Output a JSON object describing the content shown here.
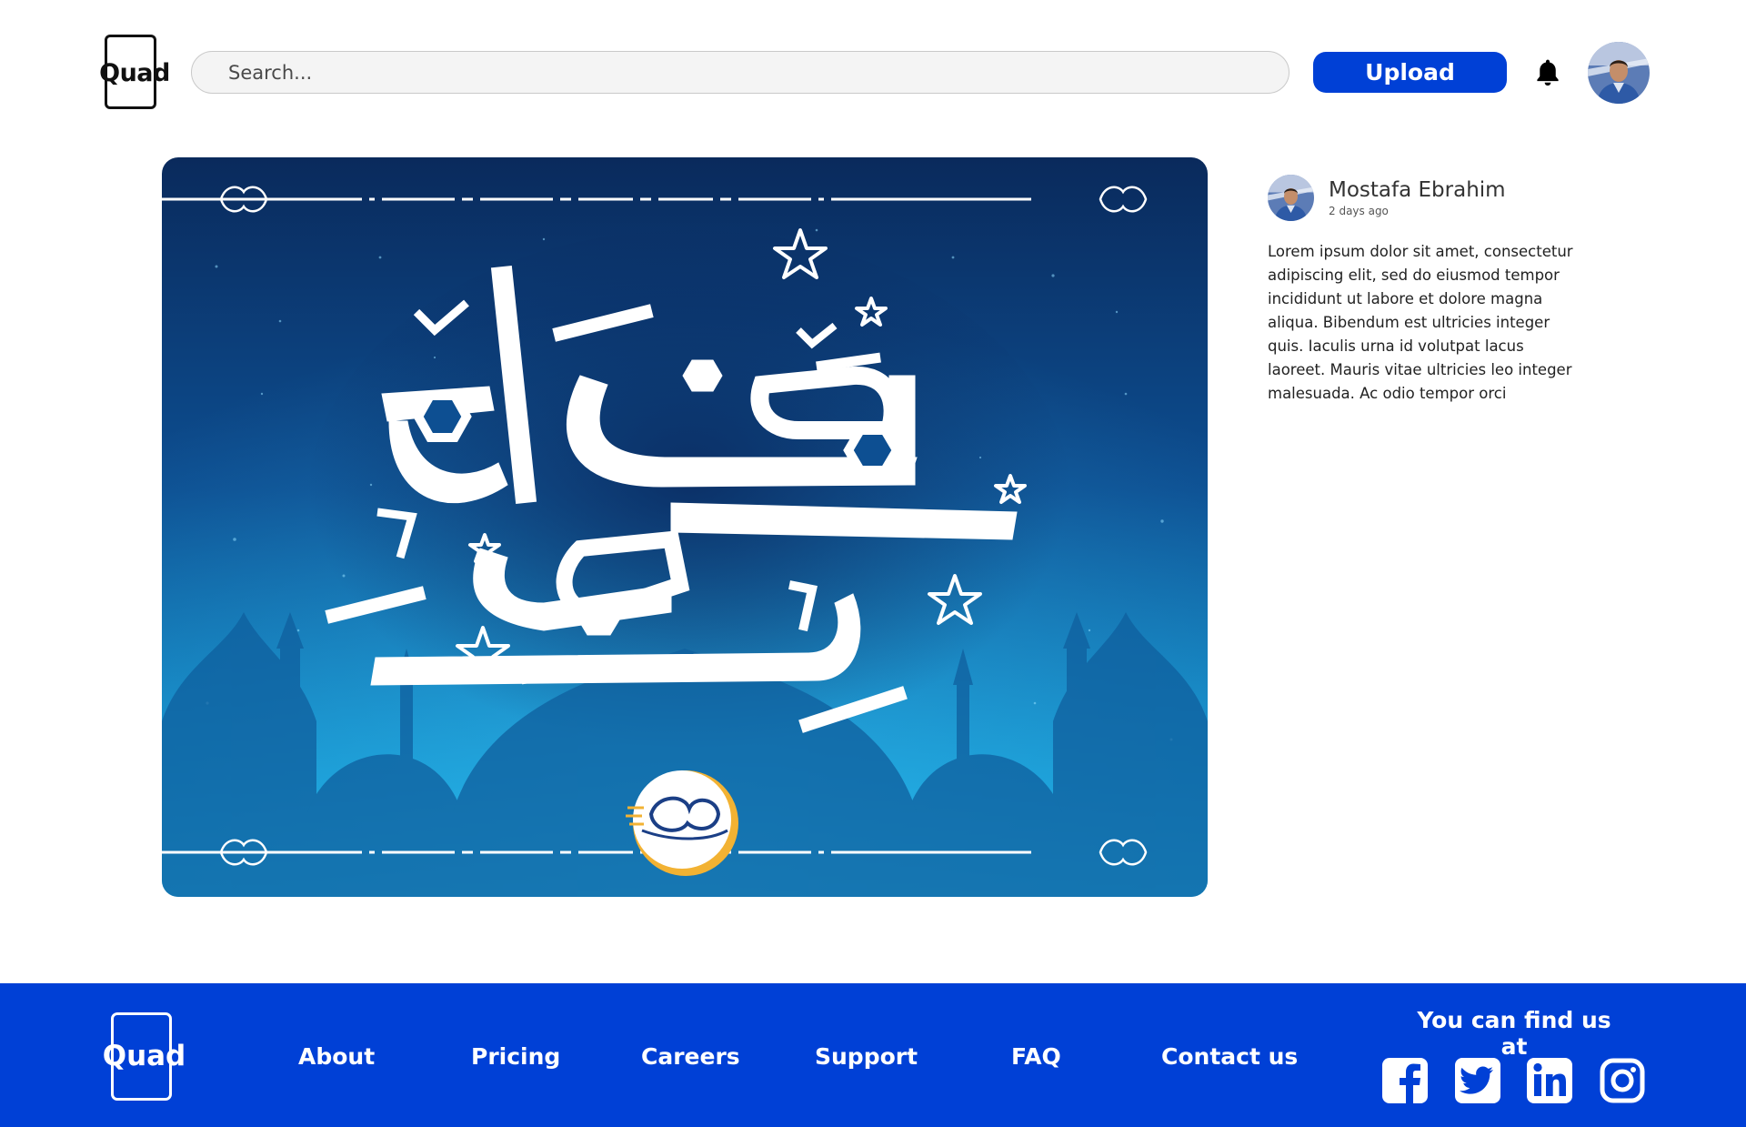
{
  "header": {
    "logo_text": "Quad",
    "search_placeholder": "Search...",
    "upload_label": "Upload",
    "icons": {
      "notifications": "bell-icon",
      "profile": "avatar"
    }
  },
  "post": {
    "author": "Mostafa Ebrahim",
    "time_ago": "2 days ago",
    "description": " Lorem ipsum dolor sit amet, consectetur adipiscing elit, sed do eiusmod tempor incididunt ut labore et dolore magna aliqua. Bibendum est ultricies integer quis. Iaculis urna id volutpat lacus laoreet. Mauris vitae ultricies leo integer malesuada. Ac odio tempor orci"
  },
  "footer": {
    "logo_text": "Quad",
    "nav": [
      "About",
      "Pricing",
      "Careers",
      "Support",
      "FAQ",
      "Contact us"
    ],
    "find_us_label": "You can find us at",
    "social": [
      "facebook-icon",
      "twitter-icon",
      "linkedin-icon",
      "instagram-icon"
    ]
  },
  "colors": {
    "brand_blue": "#0040d6",
    "hero_dark": "#0a2f66",
    "hero_light": "#1aa6dd"
  }
}
